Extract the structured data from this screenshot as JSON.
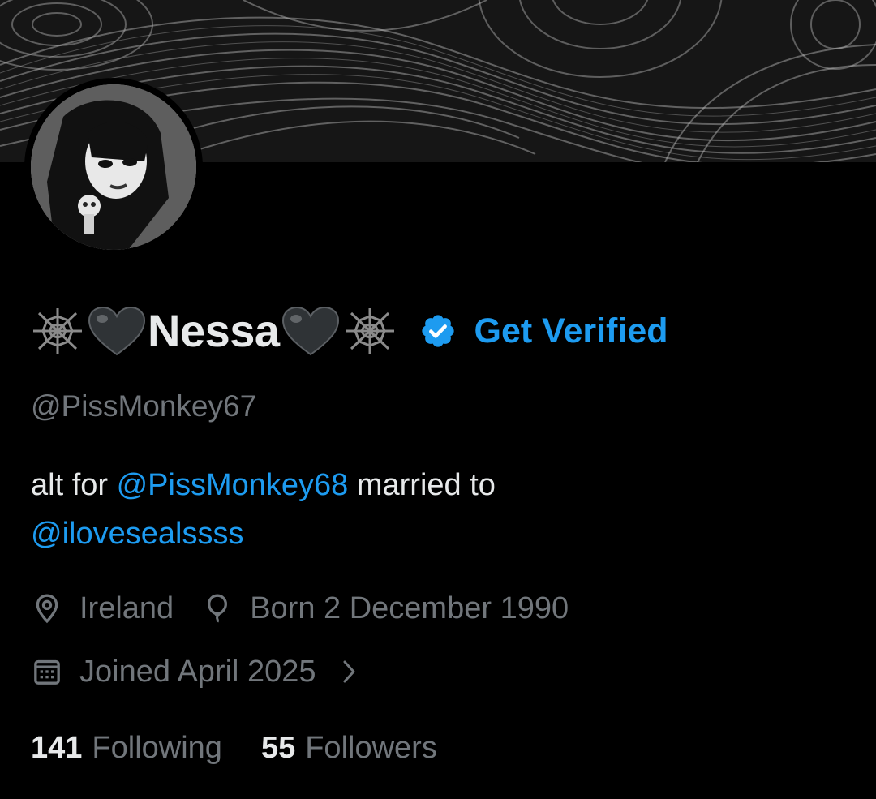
{
  "profile": {
    "display_name": "Nessa",
    "get_verified_label": "Get Verified",
    "handle": "@PissMonkey67",
    "bio": {
      "prefix": "alt for",
      "mention1": "@PissMonkey68",
      "middle": "married to",
      "mention2": "@ilovesealssss"
    },
    "location": "Ireland",
    "birthday": "Born 2 December 1990",
    "joined": "Joined April 2025",
    "following_count": "141",
    "following_label": "Following",
    "followers_count": "55",
    "followers_label": "Followers"
  },
  "icons": {
    "name_prefix": [
      "spider-web-icon",
      "black-heart-icon"
    ],
    "name_suffix": [
      "black-heart-icon",
      "spider-web-icon"
    ],
    "verified": "verified-badge-icon",
    "location": "location-pin-icon",
    "birthday": "balloon-icon",
    "joined": "calendar-icon",
    "joined_more": "chevron-right-icon"
  },
  "colors": {
    "background": "#000000",
    "primary_text": "#e7e9ea",
    "secondary_text": "#71767b",
    "accent": "#1d9bf0"
  }
}
